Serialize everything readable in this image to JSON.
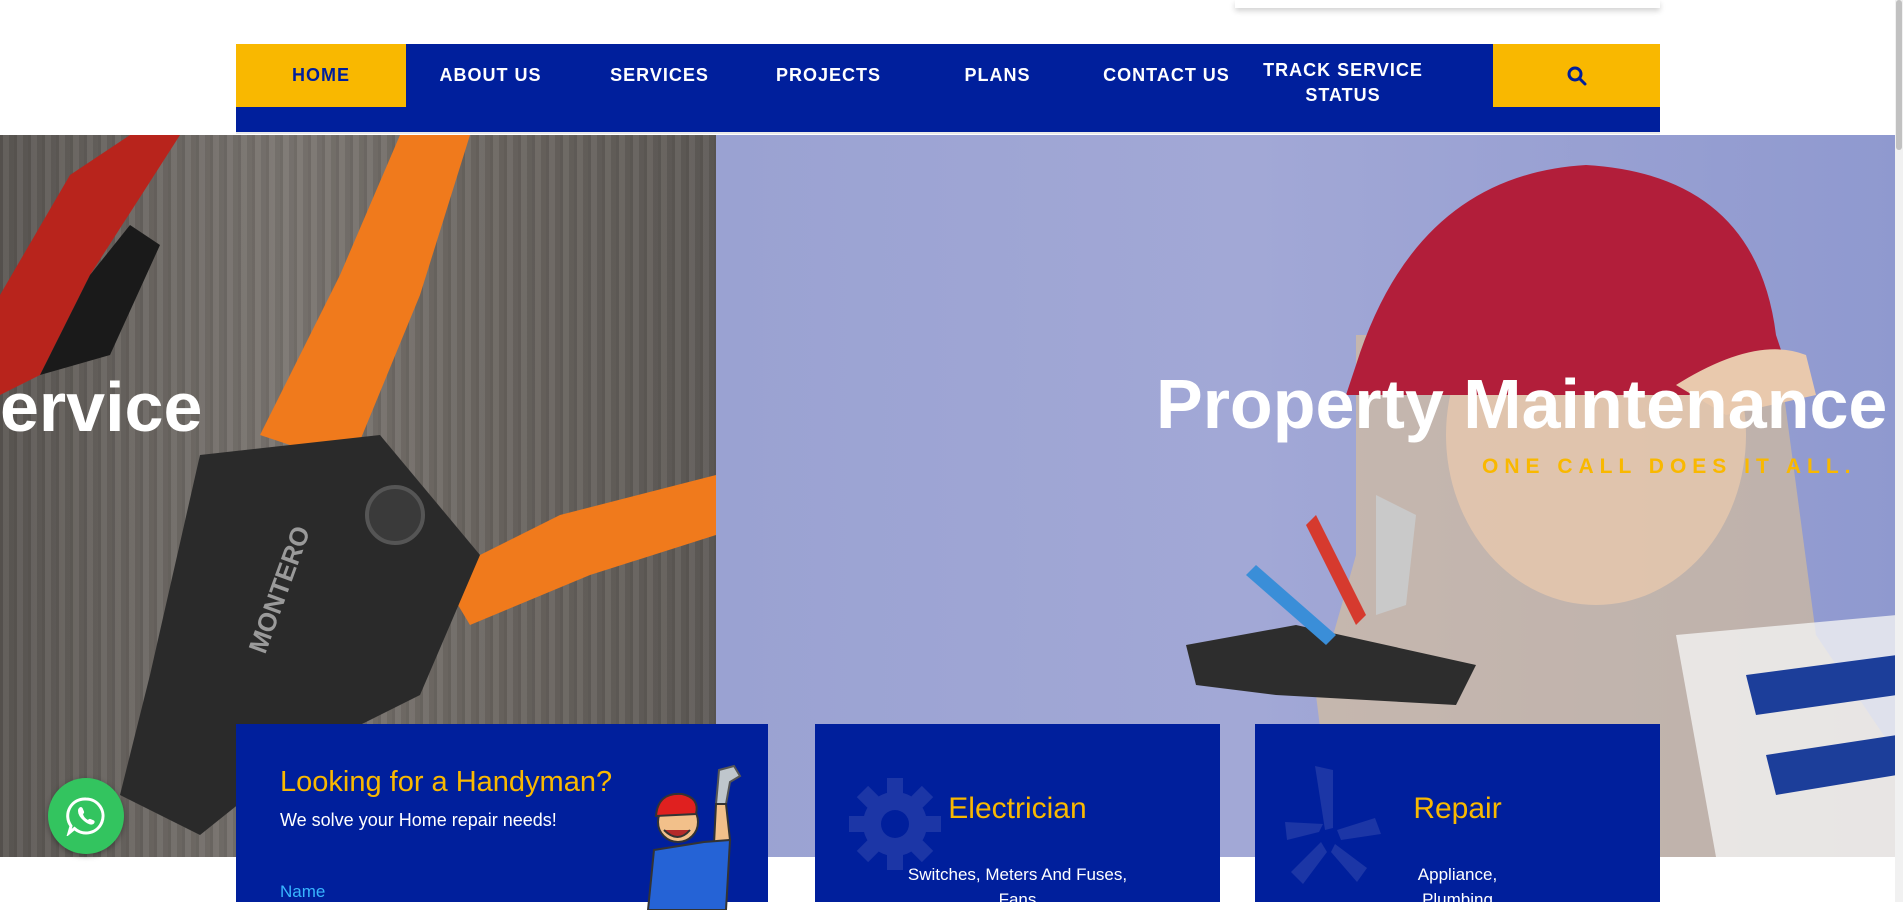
{
  "nav": {
    "items": [
      "HOME",
      "ABOUT US",
      "SERVICES",
      "PROJECTS",
      "PLANS",
      "CONTACT US",
      "TRACK SERVICE STATUS"
    ],
    "active": "HOME",
    "search_icon": "search-icon"
  },
  "hero": {
    "left_text": "ervice",
    "title": "Property Maintenance",
    "subtitle": "ONE CALL DOES IT ALL.",
    "slide_count": 3,
    "active_slide": 3
  },
  "handyman": {
    "heading": "Looking for a Handyman?",
    "subheading": "We solve your Home repair needs!",
    "name_label": "Name"
  },
  "services": [
    {
      "title": "Electrician",
      "desc_line1": "Switches, Meters And Fuses,",
      "desc_line2": "Fans",
      "icon": "gear-icon"
    },
    {
      "title": "Repair",
      "desc_line1": "Appliance,",
      "desc_line2": "Plumbing",
      "icon": "yelp-icon"
    }
  ],
  "colors": {
    "primary": "#001f9c",
    "accent": "#f9b800",
    "whatsapp": "#33c45f"
  }
}
